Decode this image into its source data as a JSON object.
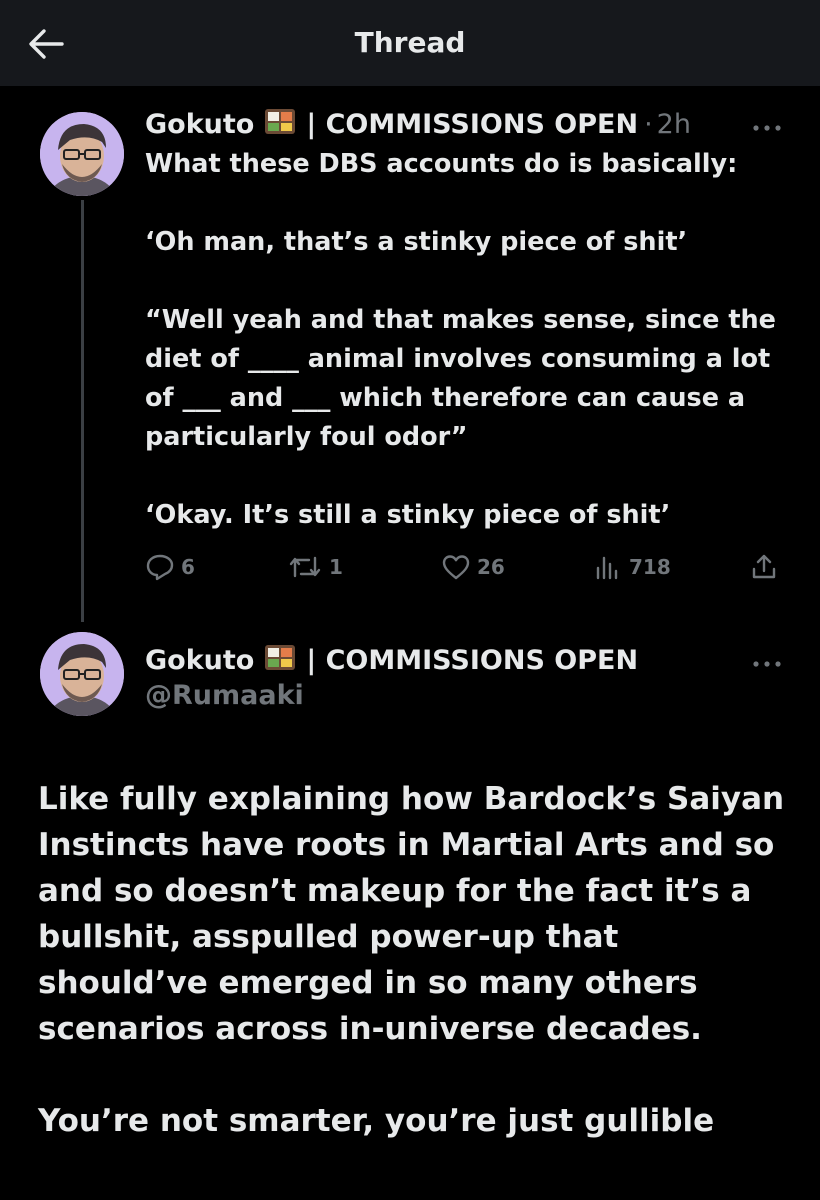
{
  "header": {
    "title": "Thread",
    "back_icon": "arrow-left-icon"
  },
  "parent_tweet": {
    "display_name": "Gokuto",
    "name_suffix": "| COMMISSIONS OPEN",
    "emoji_icon": "bento-box-icon",
    "separator": "·",
    "time_ago": "2h",
    "text": "What these DBS accounts do is basically:\n\n‘Oh man, that’s a stinky piece of shit’\n\n“Well yeah and that makes sense, since the diet of ____ animal involves consuming a lot of ___ and ___ which therefore can cause a particularly foul odor”\n\n‘Okay. It’s still a stinky piece of shit’",
    "actions": {
      "replies": "6",
      "reposts": "1",
      "likes": "26",
      "views": "718"
    }
  },
  "main_tweet": {
    "display_name": "Gokuto",
    "name_suffix": "| COMMISSIONS OPEN",
    "emoji_icon": "bento-box-icon",
    "handle": "@Rumaaki",
    "text": "Like fully explaining how Bardock’s Saiyan Instincts have roots in Martial Arts and so and so doesn’t makeup for the fact it’s a bullshit, asspulled power-up that should’ve emerged in so many others scenarios across in-universe decades.\n\nYou’re not smarter, you’re just gullible"
  },
  "colors": {
    "background": "#000000",
    "header_bg": "#16181c",
    "text": "#e7e9ea",
    "muted": "#71767b",
    "thread_line": "#3b3f44"
  }
}
